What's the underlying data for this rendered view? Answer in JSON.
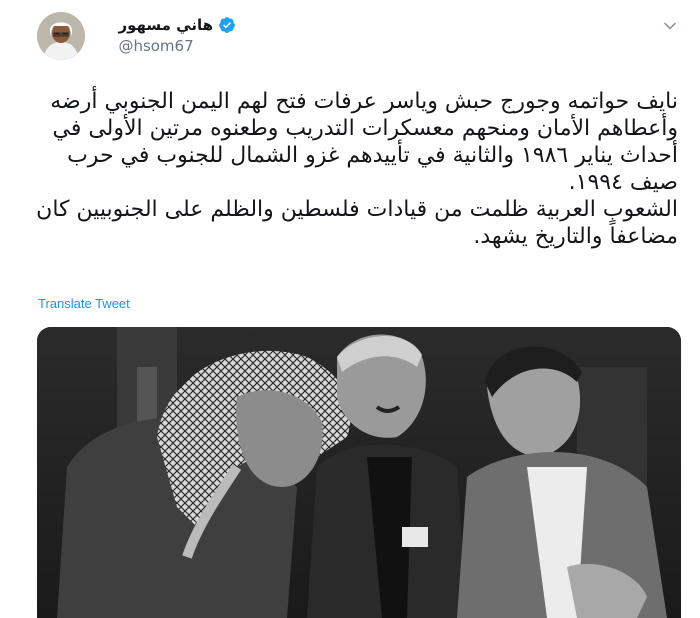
{
  "tweet": {
    "author": {
      "display_name": "هاني مسهور",
      "handle": "@hsom67",
      "verified": true
    },
    "text": [
      "نايف حواتمه وجورج حبش وياسر عرفات فتح لهم اليمن الجنوبي أرضه وأعطاهم الأمان ومنحهم معسكرات التدريب وطعنوه مرتين الأولى في أحداث يناير ١٩٨٦ والثانية في تأييدهم غزو الشمال للجنوب في حرب صيف ١٩٩٤.",
      "الشعوب العربية ظلمت من قيادات فلسطين والظلم على الجنوبيين كان مضاعفاً والتاريخ يشهد."
    ],
    "translate_label": "Translate Tweet",
    "media": {
      "type": "photo",
      "style": "black-and-white"
    }
  },
  "icons": {
    "verified": "verified-badge-icon",
    "menu": "chevron-down-icon"
  },
  "colors": {
    "link": "#1b95e0",
    "verified": "#1da1f2",
    "handle": "#657786",
    "text": "#14171a"
  }
}
